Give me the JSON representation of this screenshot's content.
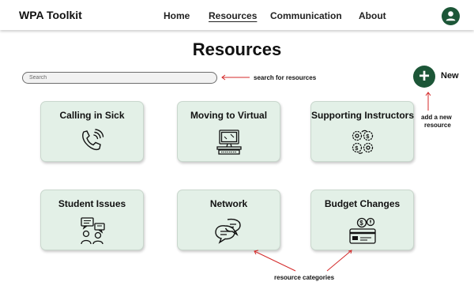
{
  "header": {
    "brand": "WPA Toolkit",
    "nav": [
      "Home",
      "Resources",
      "Communication",
      "About"
    ],
    "active_nav": "Resources",
    "avatar_icon": "user-icon"
  },
  "page": {
    "title": "Resources"
  },
  "search": {
    "placeholder": "Search",
    "annotation": "search for resources"
  },
  "new_button": {
    "label": "New",
    "icon": "plus-icon",
    "annotation_line1": "add a new",
    "annotation_line2": "resource"
  },
  "categories": [
    {
      "label": "Calling in Sick",
      "icon": "phone-icon"
    },
    {
      "label": "Moving to Virtual",
      "icon": "computer-icon"
    },
    {
      "label": "Supporting Instructors",
      "icon": "gears-dollar-icon"
    },
    {
      "label": "Student Issues",
      "icon": "people-chat-icon"
    },
    {
      "label": "Network",
      "icon": "chat-bubbles-icon"
    },
    {
      "label": "Budget Changes",
      "icon": "money-card-icon"
    }
  ],
  "categories_annotation": "resource categories",
  "colors": {
    "brand_green": "#1c5637",
    "card_bg": "#e3f0e7",
    "annotation_red": "#d42a2a"
  }
}
